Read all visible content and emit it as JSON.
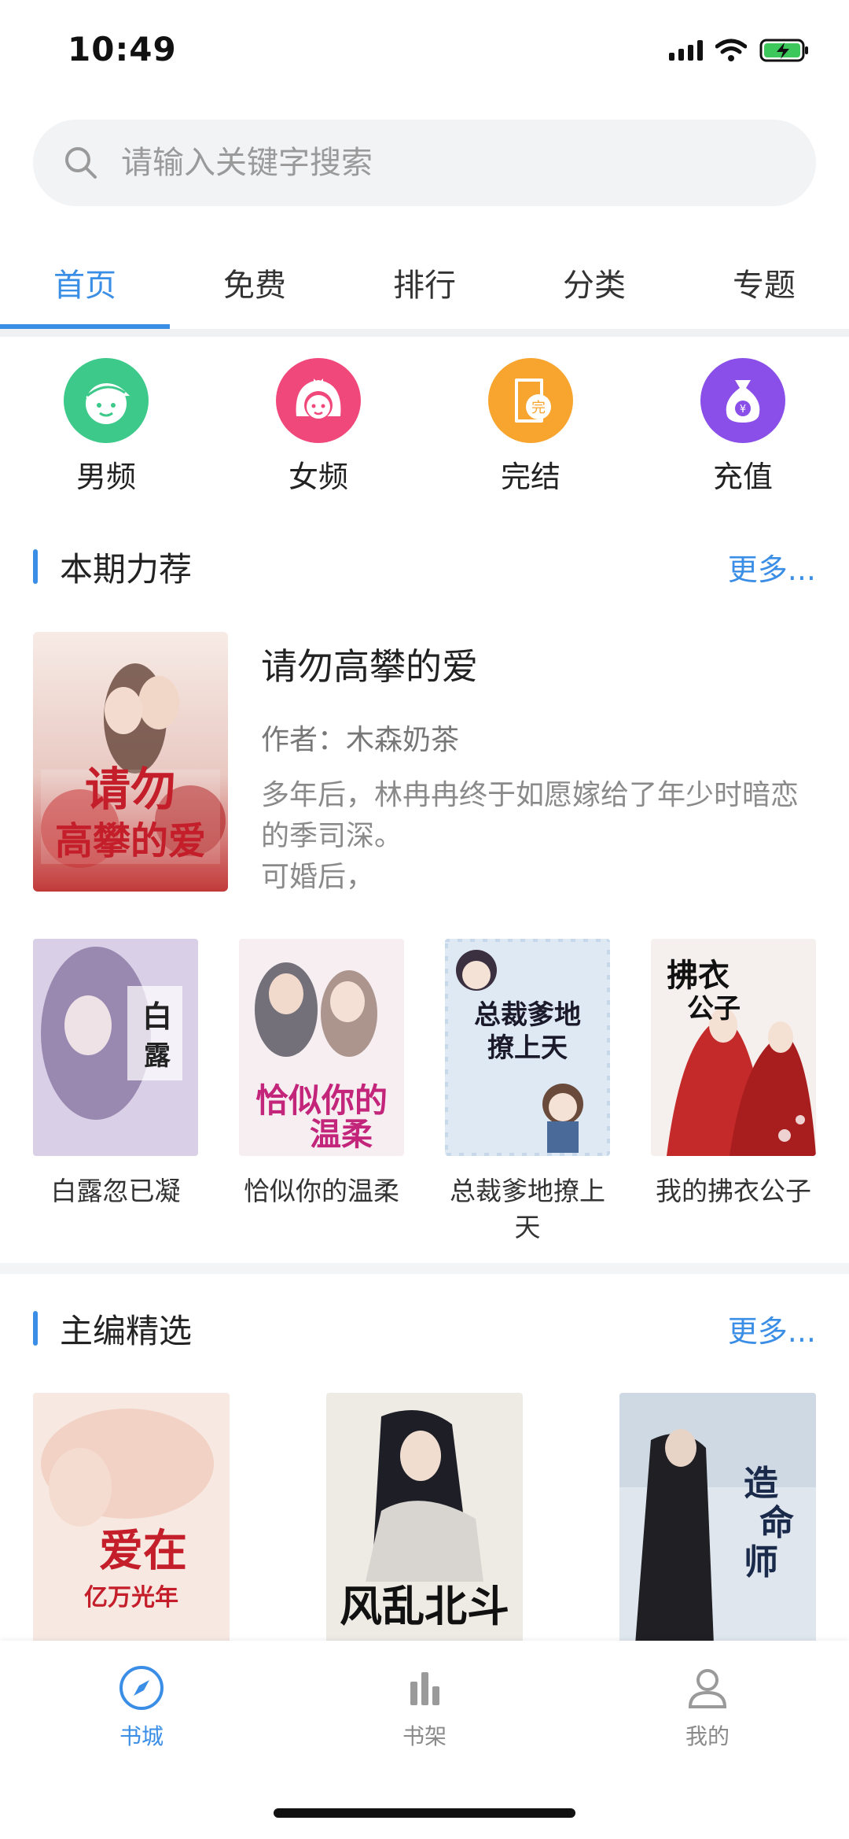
{
  "status_bar": {
    "time": "10:49",
    "icons": [
      "signal-icon",
      "wifi-icon",
      "battery-charging-icon"
    ]
  },
  "search": {
    "placeholder": "请输入关键字搜索"
  },
  "tabs": [
    {
      "label": "首页",
      "active": true
    },
    {
      "label": "免费",
      "active": false
    },
    {
      "label": "排行",
      "active": false
    },
    {
      "label": "分类",
      "active": false
    },
    {
      "label": "专题",
      "active": false
    }
  ],
  "categories": [
    {
      "label": "男频",
      "icon": "boy-face-icon",
      "color": "#3cc98a"
    },
    {
      "label": "女频",
      "icon": "girl-face-icon",
      "color": "#f0487a"
    },
    {
      "label": "完结",
      "icon": "completed-book-icon",
      "color": "#f7a52e"
    },
    {
      "label": "充值",
      "icon": "money-bag-icon",
      "color": "#8a4fe8"
    }
  ],
  "recommend": {
    "title": "本期力荐",
    "more": "更多...",
    "featured": {
      "title": "请勿高攀的爱",
      "author": "作者：木森奶茶",
      "desc_line1": "多年后，林冉冉终于如愿嫁给了年少时暗恋的季司深。",
      "desc_line2": "可婚后，"
    },
    "books": [
      {
        "name": "白露忽已凝"
      },
      {
        "name": "恰似你的温柔"
      },
      {
        "name": "总裁爹地撩上天"
      },
      {
        "name": "我的拂衣公子"
      }
    ]
  },
  "editors_pick": {
    "title": "主编精选",
    "more": "更多..."
  },
  "bottom_nav": [
    {
      "label": "书城",
      "icon": "compass-icon",
      "active": true
    },
    {
      "label": "书架",
      "icon": "bookshelf-icon",
      "active": false
    },
    {
      "label": "我的",
      "icon": "profile-icon",
      "active": false
    }
  ],
  "colors": {
    "accent": "#3a8ee6",
    "text_primary": "#222222",
    "text_secondary": "#8a8a8a"
  }
}
